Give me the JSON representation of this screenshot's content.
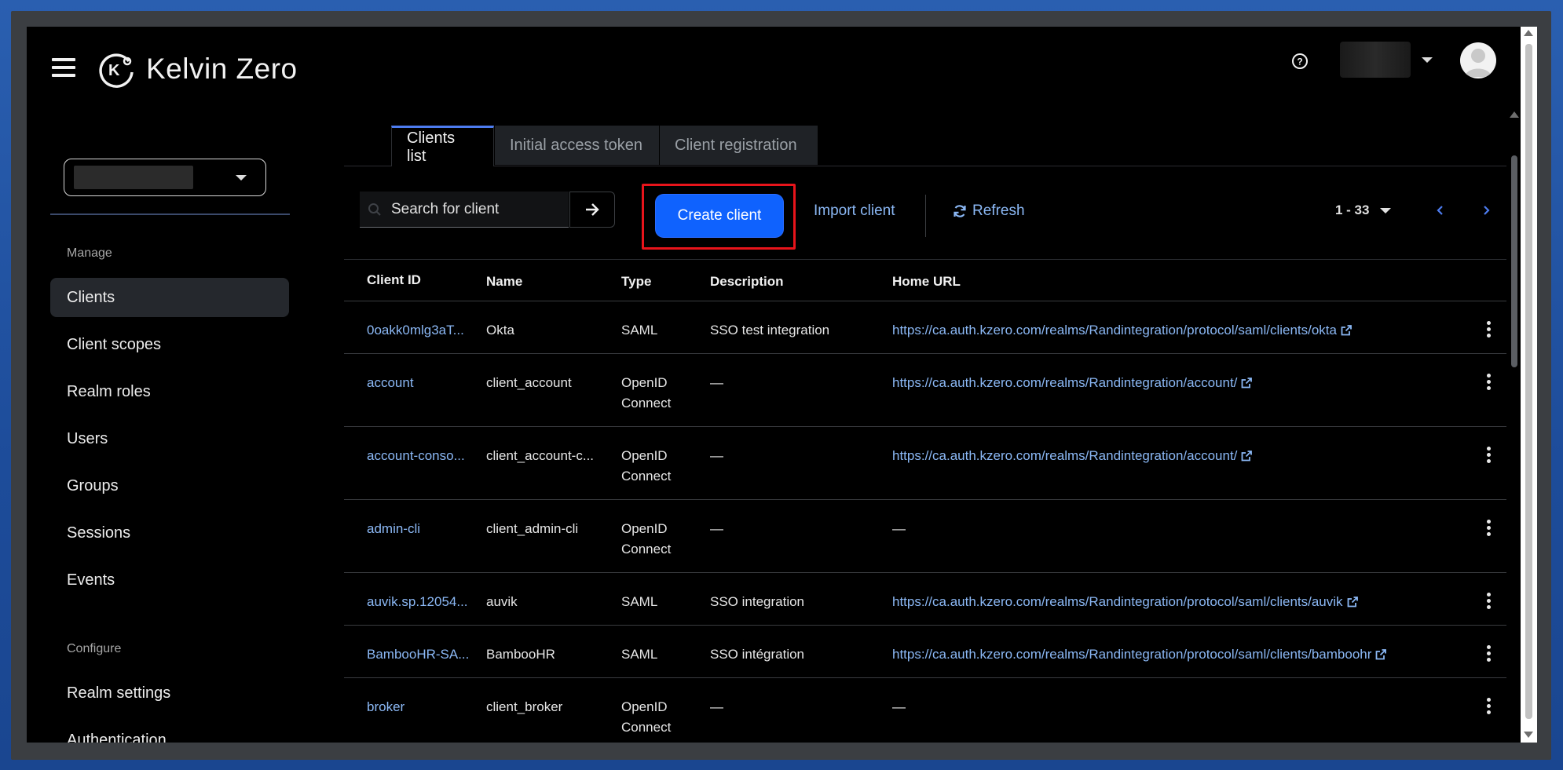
{
  "brand": {
    "name": "Kelvin Zero"
  },
  "sidebar": {
    "manage_label": "Manage",
    "configure_label": "Configure",
    "manage_items": [
      "Clients",
      "Client scopes",
      "Realm roles",
      "Users",
      "Groups",
      "Sessions",
      "Events"
    ],
    "configure_items": [
      "Realm settings",
      "Authentication"
    ],
    "active_item": "Clients"
  },
  "tabs": [
    "Clients list",
    "Initial access token",
    "Client registration"
  ],
  "toolbar": {
    "search_placeholder": "Search for client",
    "create_label": "Create client",
    "import_label": "Import client",
    "refresh_label": "Refresh",
    "pagination": "1 - 33"
  },
  "table": {
    "headers": [
      "Client ID",
      "Name",
      "Type",
      "Description",
      "Home URL"
    ],
    "rows": [
      {
        "client_id": "0oakk0mlg3aT...",
        "name": "Okta",
        "type": [
          "SAML"
        ],
        "description": "SSO test integration",
        "home_url": "https://ca.auth.kzero.com/realms/Randintegration/protocol/saml/clients/okta"
      },
      {
        "client_id": "account",
        "name": "client_account",
        "type": [
          "OpenID",
          "Connect"
        ],
        "description": "—",
        "home_url": "https://ca.auth.kzero.com/realms/Randintegration/account/"
      },
      {
        "client_id": "account-conso...",
        "name": "client_account-c...",
        "type": [
          "OpenID",
          "Connect"
        ],
        "description": "—",
        "home_url": "https://ca.auth.kzero.com/realms/Randintegration/account/"
      },
      {
        "client_id": "admin-cli",
        "name": "client_admin-cli",
        "type": [
          "OpenID",
          "Connect"
        ],
        "description": "—",
        "home_url": "—"
      },
      {
        "client_id": "auvik.sp.12054...",
        "name": "auvik",
        "type": [
          "SAML"
        ],
        "description": "SSO integration",
        "home_url": "https://ca.auth.kzero.com/realms/Randintegration/protocol/saml/clients/auvik"
      },
      {
        "client_id": "BambooHR-SA...",
        "name": "BambooHR",
        "type": [
          "SAML"
        ],
        "description": "SSO intégration",
        "home_url": "https://ca.auth.kzero.com/realms/Randintegration/protocol/saml/clients/bamboohr"
      },
      {
        "client_id": "broker",
        "name": "client_broker",
        "type": [
          "OpenID",
          "Connect"
        ],
        "description": "—",
        "home_url": "—"
      }
    ]
  },
  "colors": {
    "primary": "#0f62fe",
    "link": "#8bb8f5",
    "highlight": "#e8141b",
    "background": "#000000"
  }
}
